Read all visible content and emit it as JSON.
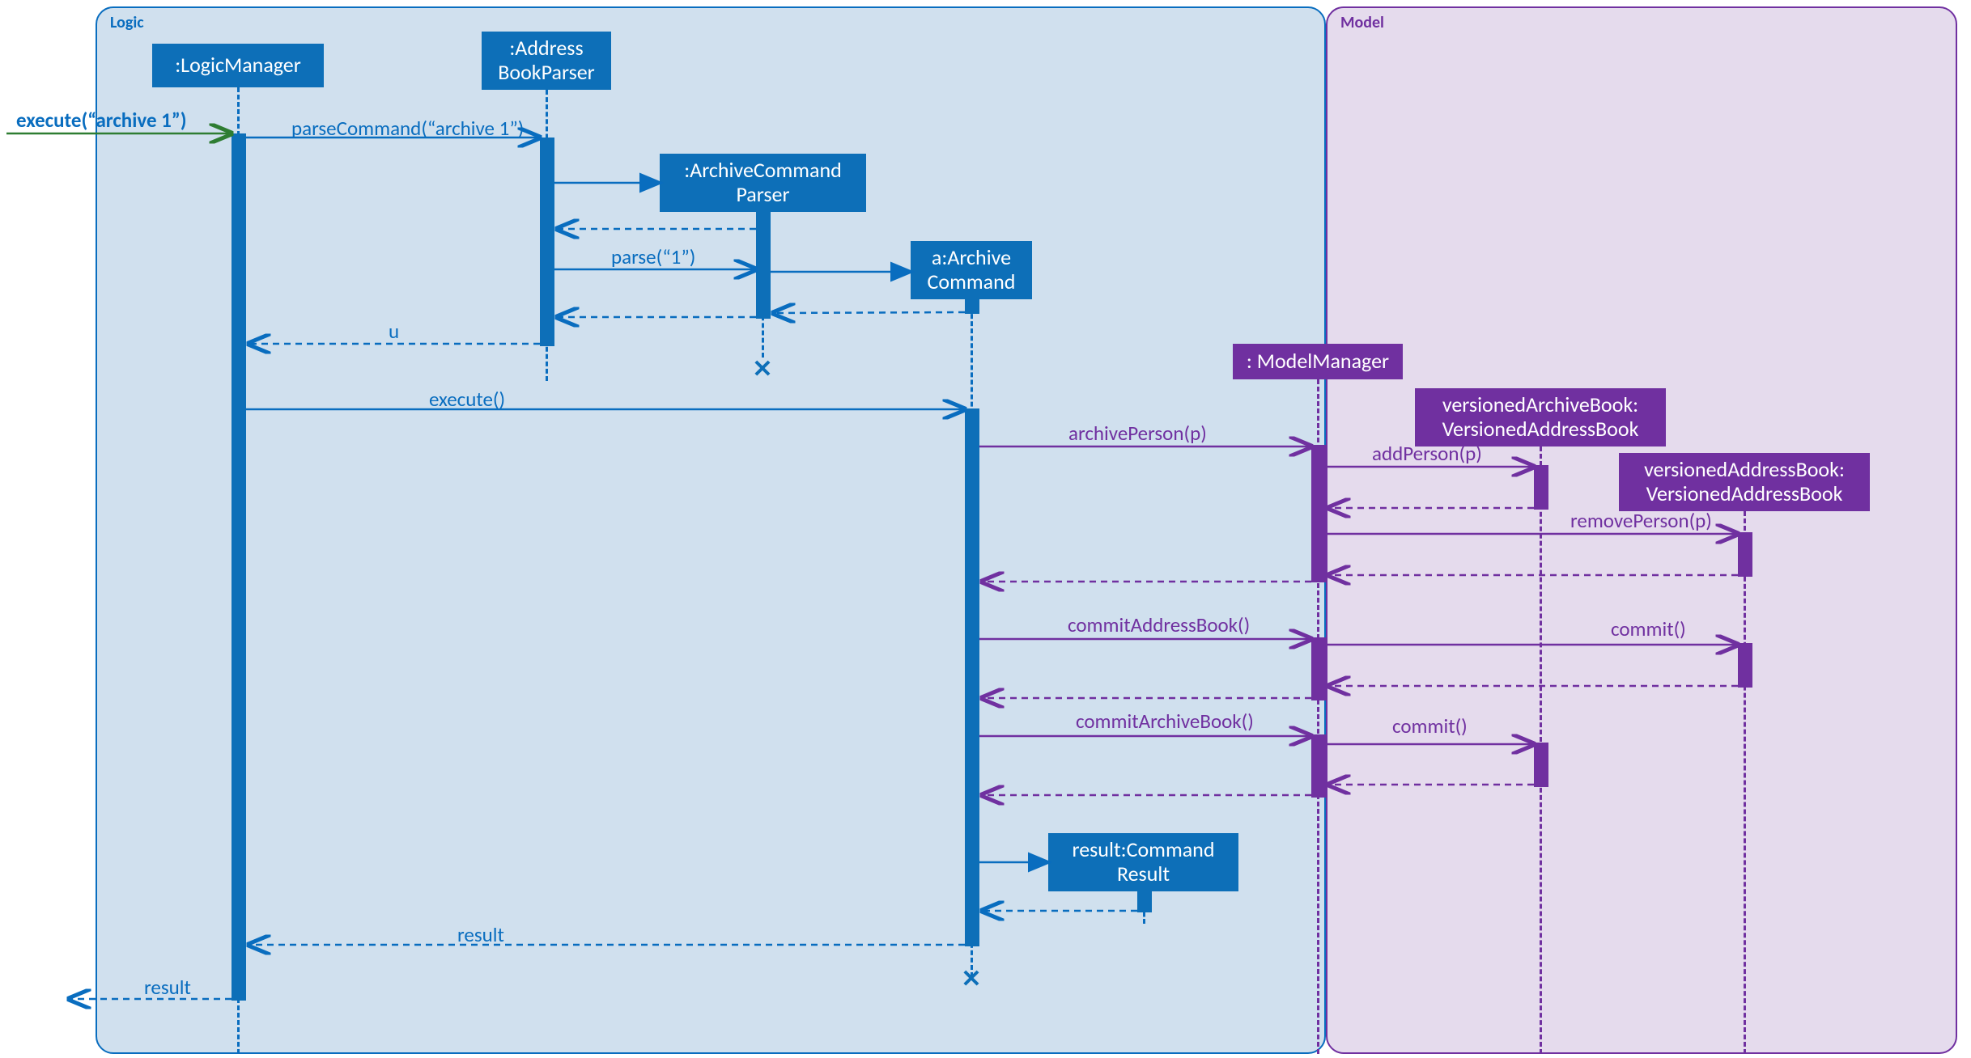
{
  "diagram": {
    "type": "sequence",
    "frames": {
      "logic": "Logic",
      "model": "Model"
    },
    "lifelines": {
      "logicManager": ":LogicManager",
      "addressBookParser": ":Address BookParser",
      "archiveCommandParser": ":ArchiveCommand Parser",
      "archiveCommand": "a:Archive Command",
      "commandResult": "result:Command Result",
      "modelManager": ": ModelManager",
      "versionedArchiveBook": "versionedArchiveBook: VersionedAddressBook",
      "versionedAddressBook": "versionedAddressBook: VersionedAddressBook"
    },
    "messages": {
      "execute_entry": "execute(“archive 1”)",
      "parseCommand": "parseCommand(“archive 1”)",
      "parse": "parse(“1”)",
      "u_return": "u",
      "execute": "execute()",
      "archivePerson": "archivePerson(p)",
      "addPerson": "addPerson(p)",
      "removePerson": "removePerson(p)",
      "commitAddressBook": "commitAddressBook()",
      "commit1": "commit()",
      "commitArchiveBook": "commitArchiveBook()",
      "commit2": "commit()",
      "result_return": "result",
      "result_out": "result"
    },
    "colors": {
      "blue": "#0d6fb8",
      "purple": "#7030a0",
      "green": "#2e7d32"
    }
  }
}
